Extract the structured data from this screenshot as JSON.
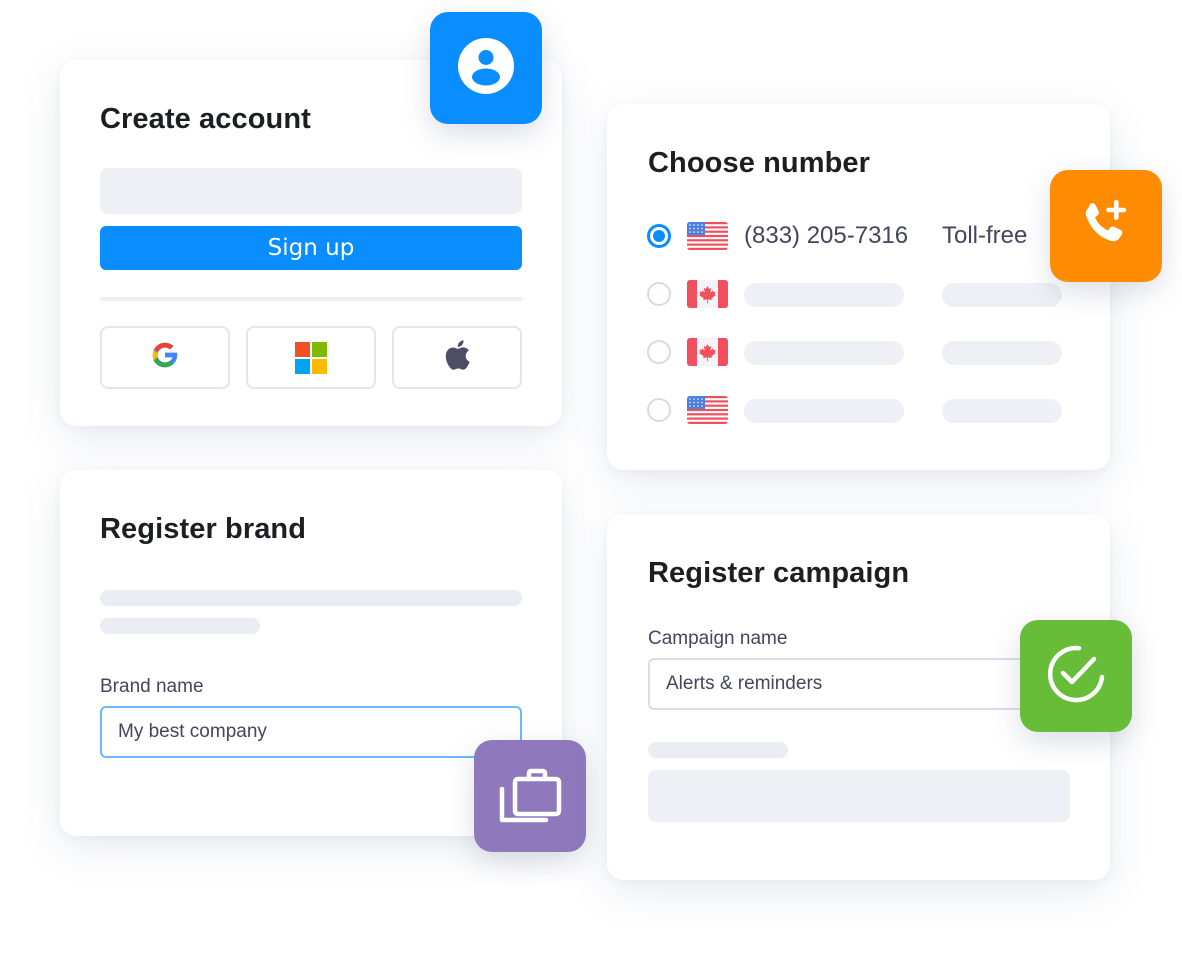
{
  "create_account": {
    "title": "Create account",
    "signup_label": "Sign up",
    "social_buttons": [
      {
        "name": "google",
        "icon": "google-icon"
      },
      {
        "name": "microsoft",
        "icon": "microsoft-icon"
      },
      {
        "name": "apple",
        "icon": "apple-icon"
      }
    ],
    "badge_icon": "user-circle-icon",
    "badge_color": "#0a8dff",
    "accent_color": "#0a8dff"
  },
  "choose_number": {
    "title": "Choose number",
    "numbers": [
      {
        "country": "US",
        "flag_icon": "us-flag-icon",
        "number": "(833) 205-7316",
        "type": "Toll-free",
        "selected": true
      },
      {
        "country": "CA",
        "flag_icon": "canada-flag-icon",
        "number": "",
        "type": "",
        "selected": false
      },
      {
        "country": "CA",
        "flag_icon": "canada-flag-icon",
        "number": "",
        "type": "",
        "selected": false
      },
      {
        "country": "US",
        "flag_icon": "us-flag-icon",
        "number": "",
        "type": "",
        "selected": false
      }
    ],
    "badge_icon": "phone-add-icon",
    "badge_color": "#ff8c00"
  },
  "register_brand": {
    "title": "Register brand",
    "field_label": "Brand name",
    "field_value": "My best company",
    "badge_icon": "briefcase-stack-icon",
    "badge_color": "#8f79bc"
  },
  "register_campaign": {
    "title": "Register campaign",
    "field_label": "Campaign name",
    "field_value": "Alerts & reminders",
    "badge_icon": "check-circle-icon",
    "badge_color": "#67bd37"
  }
}
